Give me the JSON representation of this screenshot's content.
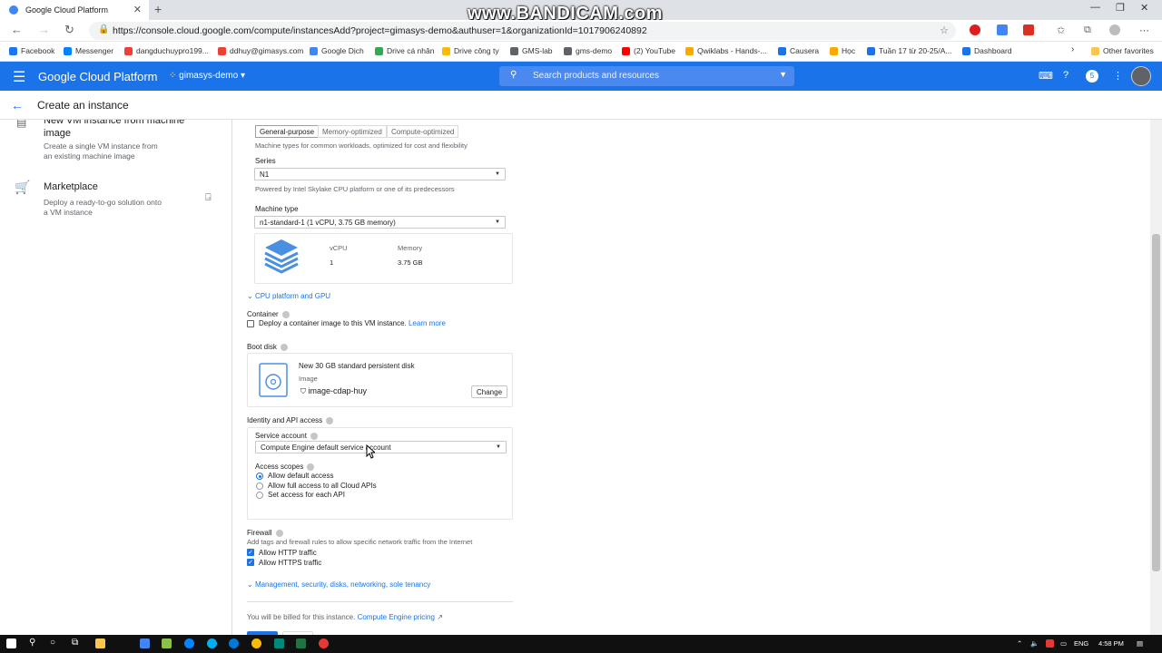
{
  "browser": {
    "tab_title": "Google Cloud Platform",
    "url": "https://console.cloud.google.com/compute/instancesAdd?project=gimasys-demo&authuser=1&organizationId=1017906240892",
    "watermark": "www.BANDICAM.com",
    "bookmarks": [
      {
        "label": "Facebook",
        "color": "#1877f2"
      },
      {
        "label": "Messenger",
        "color": "#0084ff"
      },
      {
        "label": "dangduchuypro199...",
        "color": "#ea4335"
      },
      {
        "label": "ddhuy@gimasys.com",
        "color": "#ea4335"
      },
      {
        "label": "Google Dịch",
        "color": "#4285f4"
      },
      {
        "label": "Drive cá nhân",
        "color": "#34a853"
      },
      {
        "label": "Drive công ty",
        "color": "#fbbc05"
      },
      {
        "label": "GMS-lab",
        "color": "#5f6368"
      },
      {
        "label": "gms-demo",
        "color": "#5f6368"
      },
      {
        "label": "(2) YouTube",
        "color": "#ff0000"
      },
      {
        "label": "Qwiklabs - Hands-...",
        "color": "#f9ab00"
      },
      {
        "label": "Causera",
        "color": "#1a73e8"
      },
      {
        "label": "Học",
        "color": "#f9ab00"
      },
      {
        "label": "Tuần 17 từ 20-25/A...",
        "color": "#1a73e8"
      },
      {
        "label": "Dashboard",
        "color": "#1a73e8"
      }
    ],
    "other_favorites": "Other favorites"
  },
  "gcp": {
    "product_title": "Google Cloud Platform",
    "project": "gimasys-demo",
    "search_placeholder": "Search products and resources",
    "notification_count": "5"
  },
  "page": {
    "title": "Create an instance"
  },
  "left_options": [
    {
      "title": "New VM instance from machine image",
      "desc": "Create a single VM instance from an existing machine image"
    },
    {
      "title": "Marketplace",
      "desc": "Deploy a ready-to-go solution onto a VM instance"
    }
  ],
  "machine": {
    "families": [
      "General-purpose",
      "Memory-optimized",
      "Compute-optimized"
    ],
    "family_hint": "Machine types for common workloads, optimized for cost and flexibility",
    "series_label": "Series",
    "series_value": "N1",
    "series_hint": "Powered by Intel Skylake CPU platform or one of its predecessors",
    "type_label": "Machine type",
    "type_value": "n1-standard-1 (1 vCPU, 3.75 GB memory)",
    "vcpu_label": "vCPU",
    "vcpu_value": "1",
    "memory_label": "Memory",
    "memory_value": "3.75 GB",
    "cpu_platform_link": "CPU platform and GPU"
  },
  "container": {
    "label": "Container",
    "checkbox_label": "Deploy a container image to this VM instance.",
    "learn_more": "Learn more"
  },
  "boot_disk": {
    "label": "Boot disk",
    "title": "New 30 GB standard persistent disk",
    "image_label": "Image",
    "image_value": "image-cdap-huy",
    "change_button": "Change"
  },
  "identity": {
    "label": "Identity and API access",
    "service_account_label": "Service account",
    "service_account_value": "Compute Engine default service account",
    "access_scopes_label": "Access scopes",
    "scopes": [
      "Allow default access",
      "Allow full access to all Cloud APIs",
      "Set access for each API"
    ]
  },
  "firewall": {
    "label": "Firewall",
    "hint": "Add tags and firewall rules to allow specific network traffic from the Internet",
    "http": "Allow HTTP traffic",
    "https": "Allow HTTPS traffic"
  },
  "management_link": "Management, security, disks, networking, sole tenancy",
  "billing": {
    "text": "You will be billed for this instance.",
    "link": "Compute Engine pricing"
  },
  "taskbar": {
    "lang": "ENG",
    "time": "4:58 PM"
  }
}
